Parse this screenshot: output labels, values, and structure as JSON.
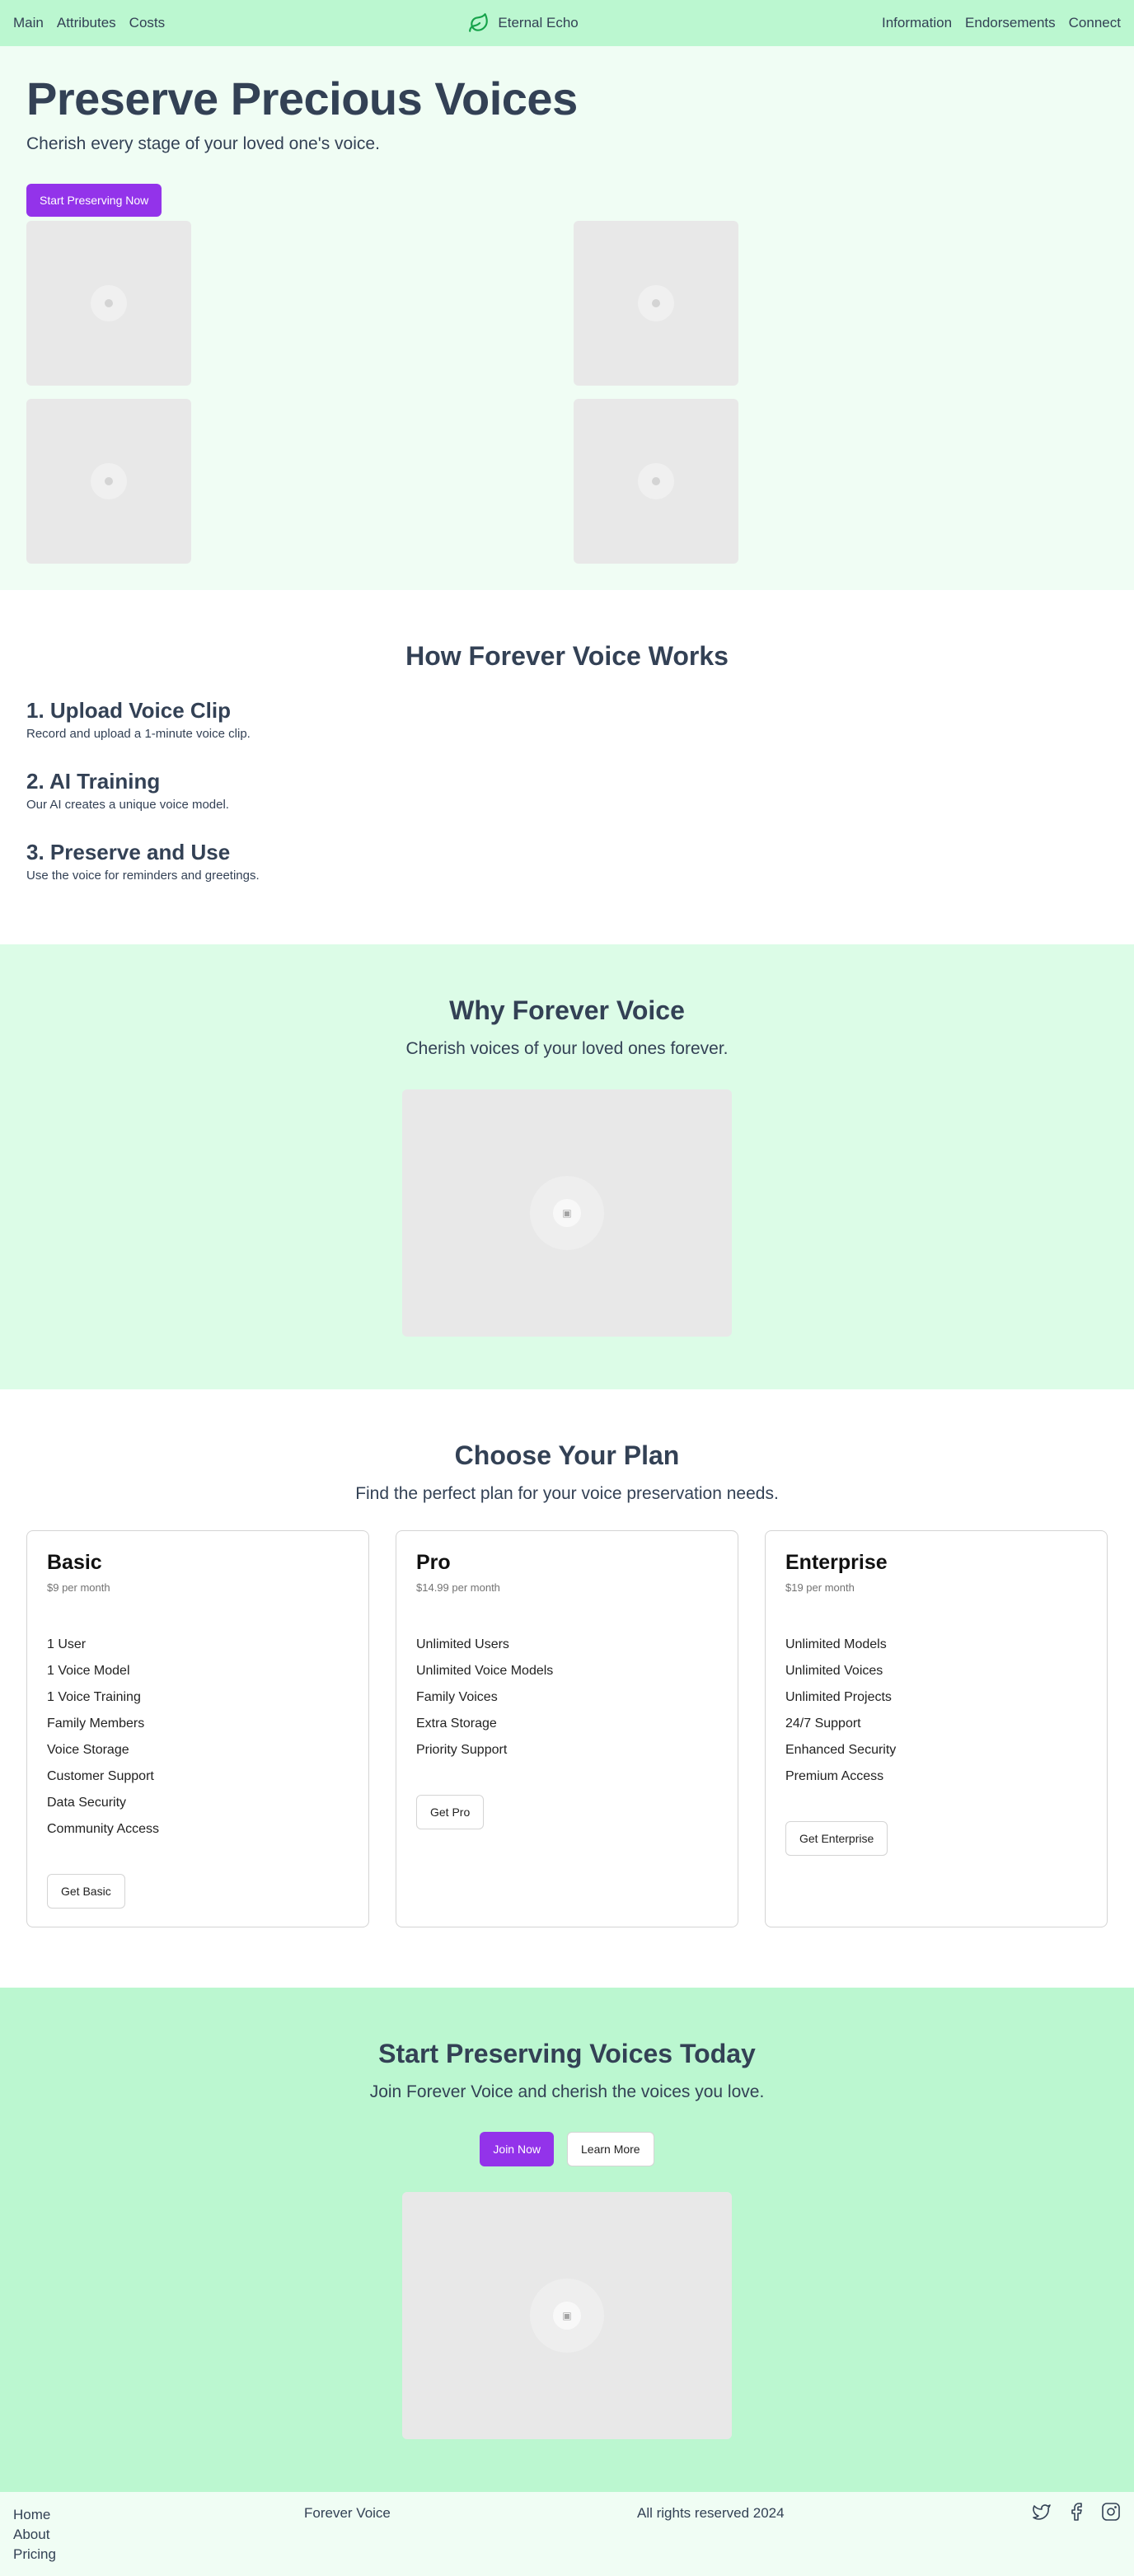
{
  "nav": {
    "left": [
      "Main",
      "Attributes",
      "Costs"
    ],
    "brand": "Eternal Echo",
    "right": [
      "Information",
      "Endorsements",
      "Connect"
    ],
    "brand_icon": "leaf-icon",
    "brand_color": "#16a34a"
  },
  "hero": {
    "title": "Preserve Precious Voices",
    "subtitle": "Cherish every stage of your loved one's voice.",
    "cta": "Start Preserving Now"
  },
  "how": {
    "title": "How Forever Voice Works",
    "steps": [
      {
        "title": "1. Upload Voice Clip",
        "text": "Record and upload a 1-minute voice clip."
      },
      {
        "title": "2. AI Training",
        "text": "Our AI creates a unique voice model."
      },
      {
        "title": "3. Preserve and Use",
        "text": "Use the voice for reminders and greetings."
      }
    ]
  },
  "why": {
    "title": "Why Forever Voice",
    "subtitle": "Cherish voices of your loved ones forever."
  },
  "plans": {
    "title": "Choose Your Plan",
    "subtitle": "Find the perfect plan for your voice preservation needs.",
    "items": [
      {
        "name": "Basic",
        "price": "$9 per month",
        "features": [
          "1 User",
          "1 Voice Model",
          "1 Voice Training",
          "Family Members",
          "Voice Storage",
          "Customer Support",
          "Data Security",
          "Community Access"
        ],
        "cta": "Get Basic"
      },
      {
        "name": "Pro",
        "price": "$14.99 per month",
        "features": [
          "Unlimited Users",
          "Unlimited Voice Models",
          "Family Voices",
          "Extra Storage",
          "Priority Support"
        ],
        "cta": "Get Pro"
      },
      {
        "name": "Enterprise",
        "price": "$19 per month",
        "features": [
          "Unlimited Models",
          "Unlimited Voices",
          "Unlimited Projects",
          "24/7 Support",
          "Enhanced Security",
          "Premium Access"
        ],
        "cta": "Get Enterprise"
      }
    ]
  },
  "cta": {
    "title": "Start Preserving Voices Today",
    "subtitle": "Join Forever Voice and cherish the voices you love.",
    "primary": "Join Now",
    "secondary": "Learn More"
  },
  "footer": {
    "links": [
      "Home",
      "About",
      "Pricing"
    ],
    "brand": "Forever Voice",
    "copyright": "All rights reserved 2024",
    "social_icons": [
      "twitter-icon",
      "facebook-icon",
      "instagram-icon"
    ]
  },
  "colors": {
    "accent": "#9333ea",
    "nav_bg": "#bbf7d0",
    "hero_bg": "#f0fdf4",
    "why_bg": "#dcfce7",
    "text": "#334155"
  }
}
